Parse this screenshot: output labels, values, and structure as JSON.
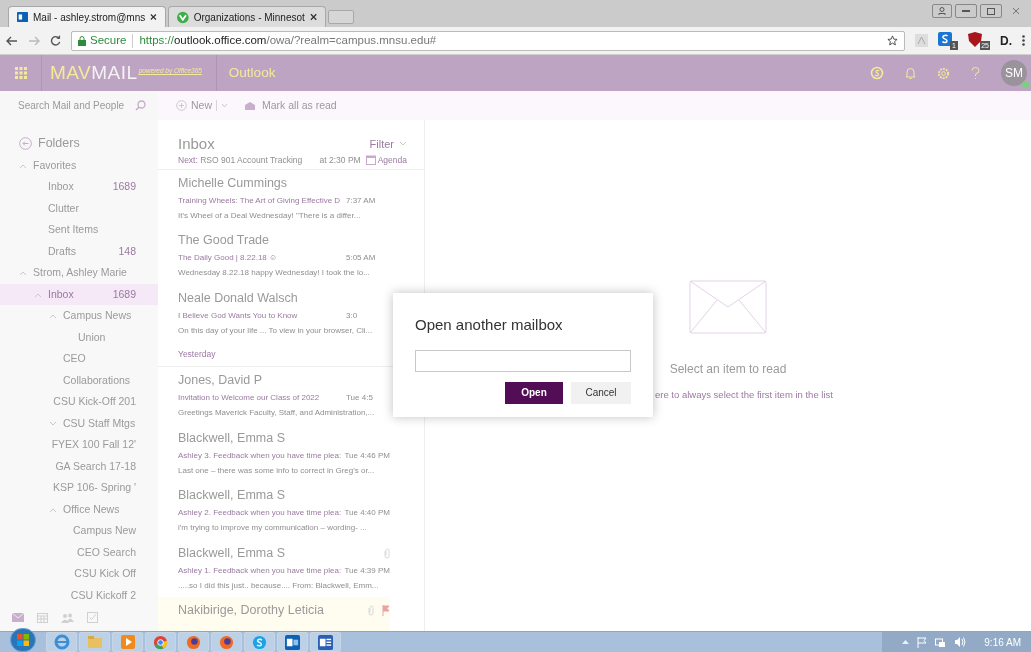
{
  "browser": {
    "tabs": [
      {
        "title": "Mail - ashley.strom@mns",
        "kind": "mail",
        "selected": true
      },
      {
        "title": "Organizations - Minnesot",
        "kind": "org",
        "selected": false
      }
    ],
    "address": {
      "secure_label": "Secure",
      "scheme": "https://",
      "host": "outlook.office.com",
      "path": "/owa/?realm=campus.mnsu.edu#"
    },
    "extensions": [
      {
        "kind": "skype",
        "badge": "1"
      },
      {
        "kind": "shield",
        "badge": "25"
      },
      {
        "kind": "letter",
        "label": "D."
      }
    ]
  },
  "header": {
    "logo_main": "MAV",
    "logo_rest": "MAIL",
    "logo_tagline": "powered by Office365",
    "app_name": "Outlook",
    "avatar": "SM"
  },
  "toolbar": {
    "search_placeholder": "Search Mail and People",
    "new_label": "New",
    "mark_read_label": "Mark all as read"
  },
  "folders": {
    "title": "Folders",
    "tree": [
      {
        "label": "Favorites",
        "expanded": true,
        "selected": false,
        "children": [
          {
            "label": "Inbox",
            "count": "1689",
            "selected": false
          },
          {
            "label": "Clutter",
            "selected": false
          },
          {
            "label": "Sent Items",
            "selected": false
          },
          {
            "label": "Drafts",
            "count": "148",
            "selected": false
          }
        ]
      },
      {
        "label": "Strom, Ashley Marie",
        "expanded": true,
        "selected": false,
        "children": [
          {
            "label": "Inbox",
            "count": "1689",
            "expanded": true,
            "selected": true,
            "children": [
              {
                "label": "Campus News",
                "expanded": true,
                "selected": false,
                "children": [
                  {
                    "label": "Union",
                    "selected": false
                  }
                ]
              },
              {
                "label": "CEO",
                "selected": false
              },
              {
                "label": "Collaborations",
                "selected": false
              },
              {
                "label": "CSU Kick-Off 201",
                "selected": false
              },
              {
                "label": "CSU Staff Mtgs",
                "expanded": false,
                "selected": false
              },
              {
                "label": "FYEX 100 Fall 12'",
                "selected": false
              },
              {
                "label": "GA Search 17-18",
                "selected": false
              },
              {
                "label": "KSP 106- Spring '",
                "selected": false
              },
              {
                "label": "Office News",
                "expanded": true,
                "selected": false,
                "children": [
                  {
                    "label": "Campus New",
                    "selected": false
                  },
                  {
                    "label": "CEO Search",
                    "selected": false
                  },
                  {
                    "label": "CSU Kick Off",
                    "selected": false
                  },
                  {
                    "label": "CSU Kickoff 2",
                    "selected": false
                  }
                ]
              }
            ]
          }
        ]
      }
    ]
  },
  "message_list": {
    "title": "Inbox",
    "filter_label": "Filter",
    "next_label": "Next:",
    "next_event": "RSO 901 Account Tracking",
    "next_time": "at 2:30 PM",
    "agenda_label": "Agenda",
    "items": [
      {
        "kind": "message",
        "sender": "Michelle Cummings",
        "subject": "Training Wheels: The Art of Giving Effective D",
        "time": "7:37 AM",
        "preview": "It's Wheel of a Deal Wednesday!     \"There is a differ...",
        "attachment": false,
        "flagged": false
      },
      {
        "kind": "message",
        "sender": "The Good Trade",
        "subject": "The Daily Good | 8.22.18 ☺",
        "time": "5:05 AM",
        "preview": "Wednesday 8.22.18  happy Wednesday! I took the lo...",
        "attachment": false,
        "flagged": false
      },
      {
        "kind": "message",
        "sender": "Neale Donald Walsch",
        "subject": "I Believe God Wants You to Know",
        "time": "3:0",
        "preview": "On this day of your life ...  To view in your browser, Cli...",
        "attachment": false,
        "flagged": false
      },
      {
        "kind": "divider",
        "label": "Yesterday"
      },
      {
        "kind": "message",
        "sender": "Jones, David P",
        "subject": "Invitation to Welcome our Class of 2022",
        "time": "Tue 4:5",
        "preview": "Greetings Maverick Faculty, Staff, and Administration,...",
        "attachment": false,
        "flagged": false
      },
      {
        "kind": "message",
        "sender": "Blackwell, Emma S",
        "subject": "Ashley 3. Feedback when you have time plea:",
        "time": "Tue 4:46 PM",
        "preview": "Last one – there was some info to correct in Greg's or...",
        "attachment": false,
        "flagged": false
      },
      {
        "kind": "message",
        "sender": "Blackwell, Emma S",
        "subject": "Ashley 2. Feedback when you have time plea:",
        "time": "Tue 4:40 PM",
        "preview": "i'm trying to improve my communication – wording- ...",
        "attachment": false,
        "flagged": false
      },
      {
        "kind": "message",
        "sender": "Blackwell, Emma S",
        "subject": "Ashley 1. Feedback when you have time plea:",
        "time": "Tue 4:39 PM",
        "preview": ".....so I did this just.. because....  From: Blackwell, Emm...",
        "attachment": true,
        "flagged": false
      },
      {
        "kind": "message",
        "sender": "Nakibirige, Dorothy Leticia",
        "attachment": true,
        "flagged": true
      }
    ]
  },
  "reading_pane": {
    "empty_text": "Select an item to read",
    "link_text": "ere to always select the first item in the list"
  },
  "dialog": {
    "title": "Open another mailbox",
    "open_label": "Open",
    "cancel_label": "Cancel"
  },
  "taskbar": {
    "apps": [
      {
        "kind": "ie"
      },
      {
        "kind": "folder"
      },
      {
        "kind": "media"
      },
      {
        "kind": "chrome"
      },
      {
        "kind": "firefox"
      },
      {
        "kind": "firefox"
      },
      {
        "kind": "skype"
      },
      {
        "kind": "outlook"
      },
      {
        "kind": "word"
      }
    ],
    "clock": "9:16 AM"
  }
}
